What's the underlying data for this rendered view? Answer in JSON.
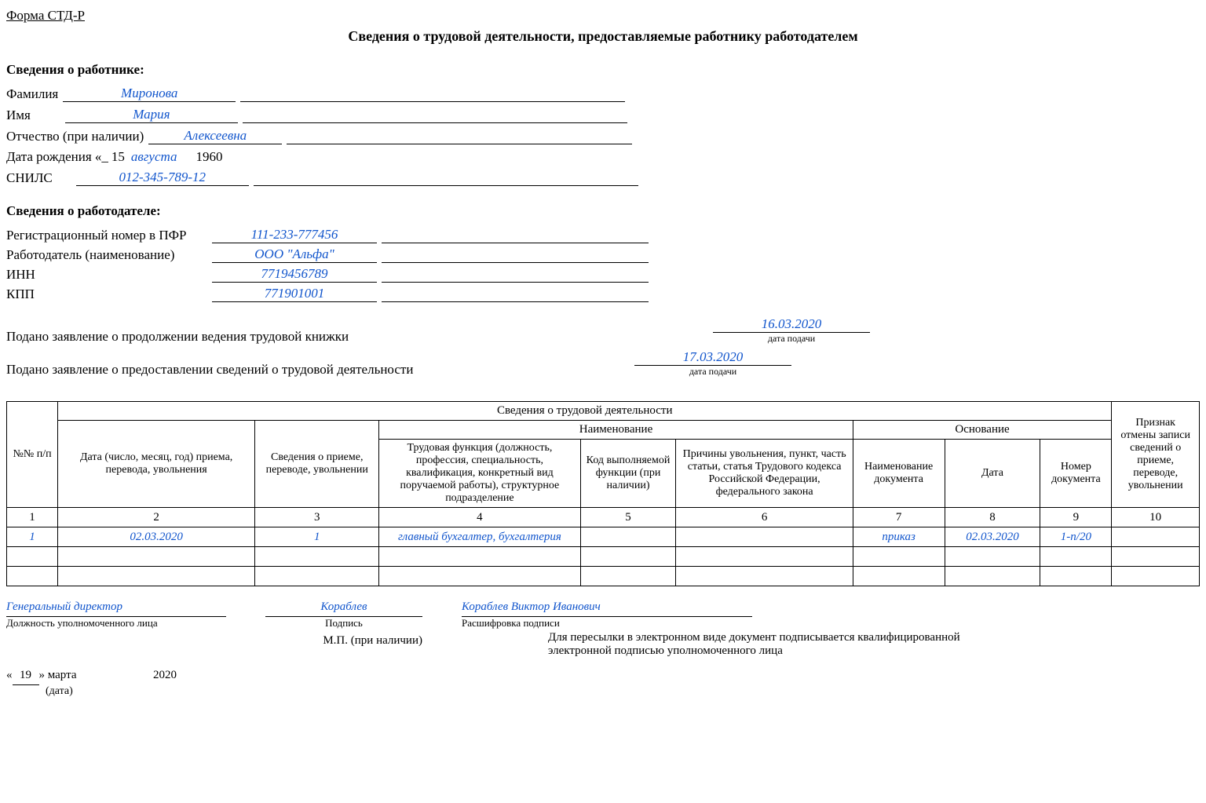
{
  "form_code": "Форма СТД-Р",
  "title": "Сведения о трудовой деятельности, предоставляемые работнику работодателем",
  "worker": {
    "heading": "Сведения о работнике:",
    "labels": {
      "surname": "Фамилия",
      "name": "Имя",
      "patronymic": "Отчество (при наличии)",
      "birth_prefix": "Дата рождения «_",
      "snils": "СНИЛС"
    },
    "values": {
      "surname": "Миронова",
      "name": "Мария",
      "patronymic": "Алексеевна",
      "birth_day": "15",
      "birth_month": "августа",
      "birth_year": "1960",
      "snils": "012-345-789-12"
    }
  },
  "employer": {
    "heading": "Сведения о работодателе:",
    "labels": {
      "reg_pfr": "Регистрационный номер в ПФР",
      "name": "Работодатель (наименование)",
      "inn": "ИНН",
      "kpp": "КПП"
    },
    "values": {
      "reg_pfr": "111-233-777456",
      "name": "ООО \"Альфа\"",
      "inn": "7719456789",
      "kpp": "771901001"
    }
  },
  "requests": {
    "r1_label": "Подано заявление о продолжении ведения трудовой книжки",
    "r1_date": "16.03.2020",
    "r2_label": "Подано заявление о предоставлении сведений о трудовой деятельности",
    "r2_date": "17.03.2020",
    "date_caption": "дата подачи"
  },
  "table": {
    "top_header": "Сведения о трудовой деятельности",
    "headers": {
      "num": "№№ п/п",
      "date": "Дата (число,  месяц, год) приема, перевода, увольнения",
      "event": "Сведения о приеме, переводе, увольнении",
      "naimen_group": "Наименование",
      "func": "Трудовая функция (должность, профессия, специальность, квалификация, конкретный вид поручаемой работы), структурное подразделение",
      "code": "Код выполняемой функции (при наличии)",
      "reasons": "Причины увольнения, пункт,  часть статьи, статья Трудового кодекса Российской Федерации, федерального закона",
      "basis_group": "Основание",
      "basis_name": "Наименование документа",
      "basis_date": "Дата",
      "basis_num": "Номер документа",
      "cancel": "Признак отмены записи сведений о приеме, переводе, увольнении"
    },
    "colnums": [
      "1",
      "2",
      "3",
      "4",
      "5",
      "6",
      "7",
      "8",
      "9",
      "10"
    ],
    "rows": [
      {
        "num": "1",
        "date": "02.03.2020",
        "event": "1",
        "func": "главный бухгалтер, бухгалтерия",
        "code": "",
        "reasons": "",
        "basis_name": "приказ",
        "basis_date": "02.03.2020",
        "basis_num": "1-п/20",
        "cancel": ""
      },
      {
        "num": "",
        "date": "",
        "event": "",
        "func": "",
        "code": "",
        "reasons": "",
        "basis_name": "",
        "basis_date": "",
        "basis_num": "",
        "cancel": ""
      },
      {
        "num": "",
        "date": "",
        "event": "",
        "func": "",
        "code": "",
        "reasons": "",
        "basis_name": "",
        "basis_date": "",
        "basis_num": "",
        "cancel": ""
      }
    ]
  },
  "signatures": {
    "position": "Генеральный директор",
    "position_caption": "Должность уполномоченного лица",
    "sign_name": "Кораблев",
    "sign_caption": "Подпись",
    "full_name": "Кораблев Виктор Иванович",
    "full_name_caption": "Расшифровка подписи",
    "mp": "М.П. (при наличии)",
    "note": "Для пересылки в электронном виде документ подписывается квалифицированной  электронной подписью уполномоченного лица",
    "date_day": "19",
    "date_month": "марта",
    "date_year": "2020",
    "date_caption": "(дата)"
  }
}
